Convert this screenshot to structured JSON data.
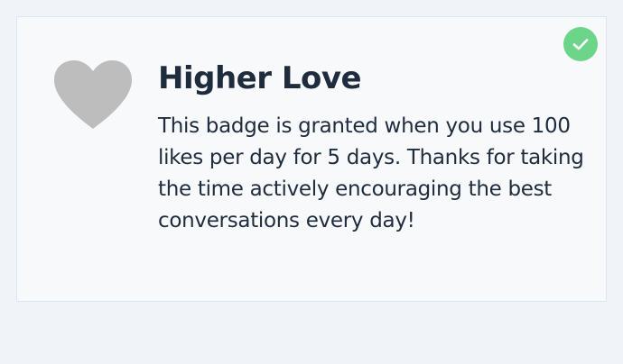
{
  "badge": {
    "title": "Higher Love",
    "description": "This badge is granted when you use 100 likes per day for 5 days. Thanks for taking the time actively encouraging the best conversations every day!",
    "icon": "heart-icon",
    "earned": true,
    "earned_icon": "check-icon"
  },
  "colors": {
    "page_background": "#f0f3f8",
    "card_background": "#f8f9fb",
    "card_border": "#dfe5ee",
    "heart": "#bdbdbd",
    "check_circle": "#6dd58a",
    "text": "#1f2c3d"
  }
}
